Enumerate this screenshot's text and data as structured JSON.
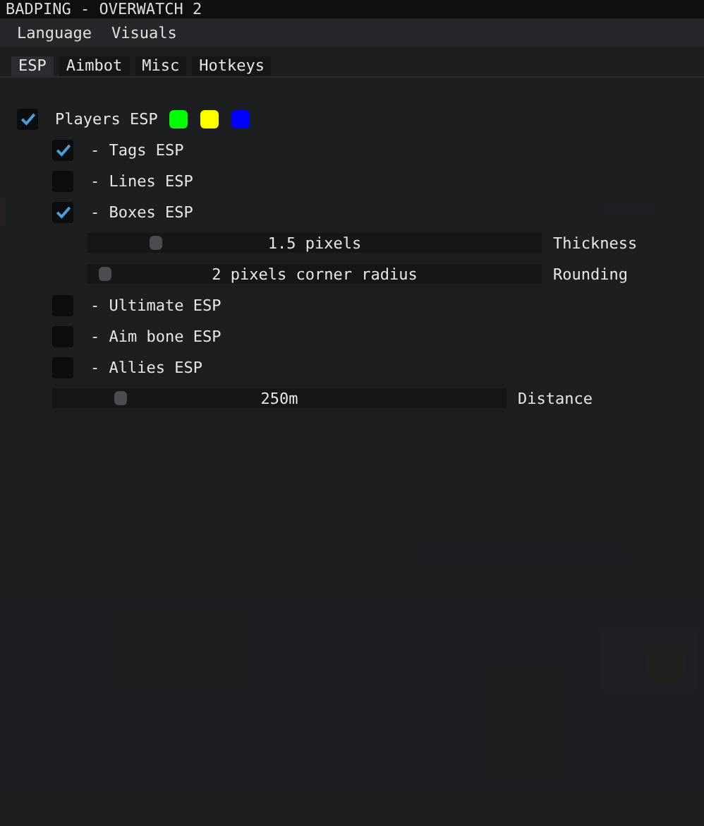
{
  "window": {
    "title": "BADPING - OVERWATCH 2"
  },
  "menu": [
    "Language",
    "Visuals"
  ],
  "tabs": [
    {
      "label": "ESP",
      "selected": true
    },
    {
      "label": "Aimbot",
      "selected": false
    },
    {
      "label": "Misc",
      "selected": false
    },
    {
      "label": "Hotkeys",
      "selected": false
    }
  ],
  "controls": [
    {
      "kind": "checkbox",
      "label": "Players ESP",
      "checked": true,
      "swatches": [
        {
          "color": "#00ff00"
        },
        {
          "color": "#ffff00"
        },
        {
          "color": "#0000ff"
        }
      ],
      "children": [
        {
          "kind": "checkbox",
          "label": "- Tags ESP",
          "checked": true
        },
        {
          "kind": "checkbox",
          "label": "- Lines ESP",
          "checked": false
        },
        {
          "kind": "checkbox",
          "label": "- Boxes ESP",
          "checked": true,
          "children": [
            {
              "kind": "slider",
              "value_text": "1.5 pixels",
              "label": "Thickness",
              "level": 0.13
            },
            {
              "kind": "slider",
              "value_text": "2 pixels corner radius",
              "label": "Rounding",
              "level": 0.02
            }
          ]
        },
        {
          "kind": "checkbox",
          "label": "- Ultimate ESP",
          "checked": false
        },
        {
          "kind": "checkbox",
          "label": "- Aim bone ESP",
          "checked": false
        },
        {
          "kind": "checkbox",
          "label": "- Allies ESP",
          "checked": false
        },
        {
          "kind": "slider",
          "value_text": "250m",
          "label": "Distance",
          "level": 0.13
        }
      ]
    }
  ]
}
